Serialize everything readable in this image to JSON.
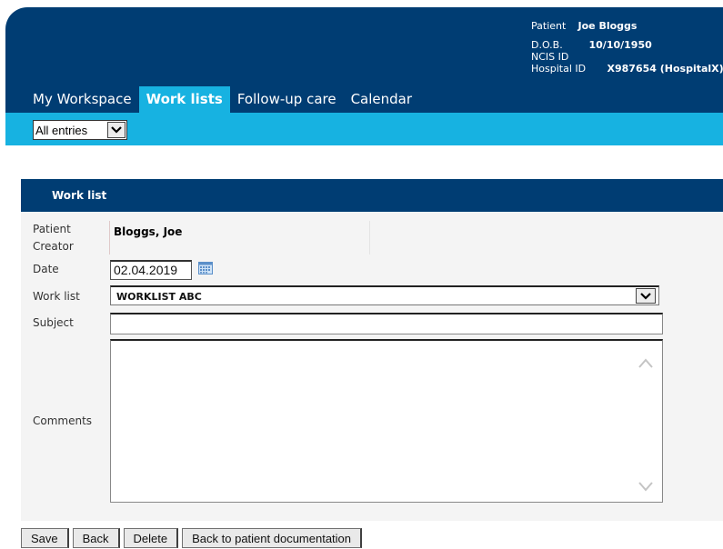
{
  "patient": {
    "name_label": "Patient",
    "name_value": "Joe Bloggs",
    "dob_label": "D.O.B.",
    "dob_value": "10/10/1950",
    "ncis_label": "NCIS ID",
    "ncis_value": "",
    "hospital_label": "Hospital ID",
    "hospital_value": "X987654 (HospitalX)"
  },
  "nav": {
    "tabs": [
      {
        "label": "My Workspace"
      },
      {
        "label": "Work lists"
      },
      {
        "label": "Follow-up care"
      },
      {
        "label": "Calendar"
      }
    ],
    "active_tab": "Work lists"
  },
  "filter": {
    "selected": "All entries"
  },
  "panel": {
    "title": "Work list"
  },
  "form": {
    "patient_label": "Patient",
    "creator_label": "Creator",
    "patient_creator_value": "Bloggs, Joe",
    "date_label": "Date",
    "date_value": "02.04.2019",
    "worklist_label": "Work list",
    "worklist_value": "WORKLIST ABC",
    "subject_label": "Subject",
    "subject_value": "",
    "comments_label": "Comments",
    "comments_value": ""
  },
  "buttons": {
    "save": "Save",
    "back": "Back",
    "delete": "Delete",
    "back_to_docs": "Back to patient documentation"
  },
  "colors": {
    "header": "#003d73",
    "accent": "#17b2e1"
  }
}
